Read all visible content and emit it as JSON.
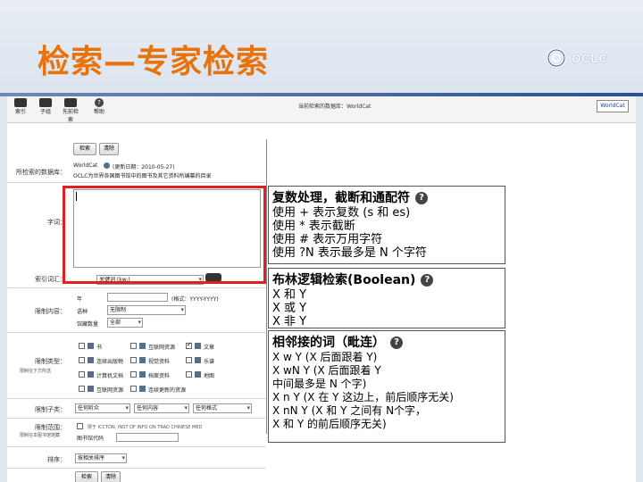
{
  "slide": {
    "title": "检索—专家检索",
    "logo_text": "OCLC"
  },
  "toolbar": {
    "items": [
      {
        "label": "索引"
      },
      {
        "label": "子组"
      },
      {
        "label": "先前检索"
      },
      {
        "label": "帮助"
      }
    ],
    "db_label": "当前检索的数据库：WorldCat",
    "logo_text": "WorldCat"
  },
  "form": {
    "search_button": "检索",
    "clear_button": "清除",
    "db_label": "所检索的数据库：",
    "db_name": "WorldCat",
    "db_update": "(更新日期：2010-05-27)",
    "db_desc": "OCLC为世界各国图书馆中的图书及其它资料所编纂的目录",
    "query_label": "字词：",
    "index_label": "索引词汇：",
    "index_value": "关键词 (kw:)",
    "limit_label": "限制内容：",
    "year_label": "年",
    "year_format": "(格式：YYYY-YYYY)",
    "lang_label": "语种",
    "lang_value": "无限制",
    "copies_label": "馆藏数量",
    "copies_value": "全部",
    "type_label": "限制类型：",
    "type_hint": "限制在下方所选",
    "types": [
      {
        "label": "书",
        "checked": false
      },
      {
        "label": "互联网资源",
        "checked": false
      },
      {
        "label": "文章",
        "checked": true
      },
      {
        "label": "连续出版物",
        "checked": false
      },
      {
        "label": "视觉资料",
        "checked": false
      },
      {
        "label": "乐谱",
        "checked": false
      },
      {
        "label": "计算机文档",
        "checked": false
      },
      {
        "label": "档案资料",
        "checked": false
      },
      {
        "label": "地图",
        "checked": false
      },
      {
        "label": "互联网资源",
        "checked": false
      },
      {
        "label": "连续更新的资源",
        "checked": false
      }
    ],
    "subtype_label": "限制子类：",
    "subtype_values": [
      "任何听众",
      "任何内容",
      "任何格式"
    ],
    "scope_label": "限制范围：",
    "scope_hint": "限制在本图书馆馆藏",
    "library_text": "图书馆代码",
    "institution_text": "限于 ICCTON, INST OF INFO ON TRAD CHINESE MED",
    "sort_label": "排序：",
    "sort_value": "按相关排序",
    "bottom_search": "检索",
    "bottom_clear": "清除"
  },
  "panels": {
    "truncation": {
      "title": "复数处理，截断和通配符",
      "lines": [
        "使用 + 表示复数 (s 和 es)",
        "使用 * 表示截断",
        "使用 # 表示万用字符",
        "使用 ?N 表示最多是 N 个字符"
      ]
    },
    "boolean": {
      "title": "布林逻辑检索(Boolean)",
      "lines": [
        "X 和 Y",
        "X 或 Y",
        "X 非 Y"
      ]
    },
    "proximity": {
      "title": "相邻接的词（毗连）",
      "lines": [
        "X w Y (X 后面跟着 Y)",
        "X wN Y (X 后面跟着 Y",
        " 中间最多是 N 个字)",
        "X n Y (X 在 Y 这边上，前后顺序无关)",
        "X nN Y (X 和 Y 之间有 N个字，",
        "  X 和 Y 的前后顺序无关)"
      ]
    }
  }
}
